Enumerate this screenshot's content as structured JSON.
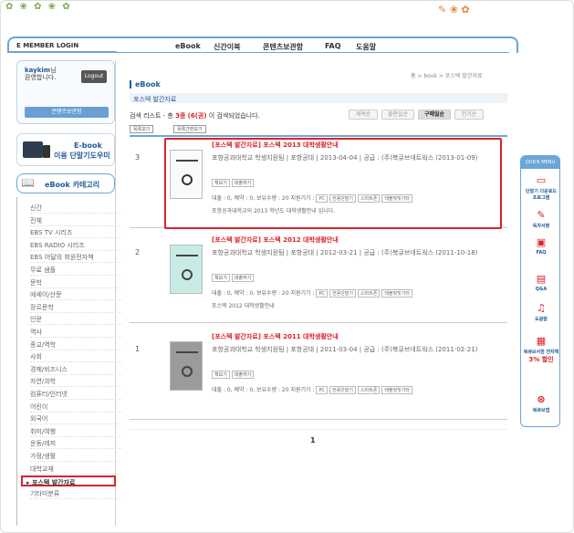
{
  "header": {
    "member_login": "E MEMBER LOGIN",
    "nav": [
      "eBook",
      "신간이북",
      "콘텐츠보관함",
      "FAQ",
      "도움말"
    ]
  },
  "login": {
    "user": "kaykim",
    "user_suffix": "님",
    "welcome": "환영합니다.",
    "logout": "Logout",
    "content_button": "콘텐츠보관함"
  },
  "app_promo": {
    "line1": "E-book",
    "line2": "이용 단말기도우미"
  },
  "category": {
    "title": "eBook 카테고리",
    "items": [
      "신간",
      "전체",
      "EBS TV 시리즈",
      "EBS RADIO 시리즈",
      "EBS 어달의 회원전자책",
      "무료 샘플",
      "문학",
      "에세이/산문",
      "장르문학",
      "인문",
      "역사",
      "종교/역학",
      "사회",
      "경제/비즈니스",
      "자연/과학",
      "컴퓨터/인터넷",
      "어린이",
      "외국어",
      "취미/여행",
      "운동/레저",
      "가정/생활",
      "대학교재",
      "포스텍 발간자료",
      "기타미분류"
    ],
    "active_index": 22
  },
  "main": {
    "section_title": "eBook",
    "breadcrumb": "홈 > book > 포스텍 발간자료",
    "sub_title": "포스텍 발간자료",
    "list_prefix": "검색 리스트 - 총 ",
    "list_count": "3종",
    "list_count_detail": "(6(권)",
    "list_suffix": " 이 검색되었습니다.",
    "sort_buttons": [
      "제목순",
      "출판일순",
      "구매일순",
      "인기순"
    ],
    "sort_selected": 2,
    "small_buttons": [
      "목록보기",
      "목록간편보기"
    ],
    "books": [
      {
        "num": "3",
        "series": "[포스텍 발간자료]",
        "title": "포스텍 2013 대학생활안내",
        "meta": "포항공과대학교 학생지원팀 | 포항공대 | 2013-04-04 | 공급 : (주)북큐브네트웍스 (2013-01-09)",
        "tools": [
          "책보기",
          "대출하기"
        ],
        "loan": "대출 : 0, 예약 : 0, 보유수량 : 20   지원기기 :",
        "devices": [
          "PC",
          "전용단말기",
          "스마트폰",
          "태블릿및기타"
        ],
        "desc": "포항공과대학교의 2013 학년도 대학생활안내 입니다."
      },
      {
        "num": "2",
        "series": "[포스텍 발간자료]",
        "title": "포스텍 2012 대학생활안내",
        "meta": "포항공과대학교 학생지원팀 | 포항공대 | 2012-03-21 | 공급 : (주)북큐브네트웍스 (2011-10-18)",
        "tools": [
          "책보기",
          "대출하기"
        ],
        "loan": "대출 : 0, 예약 : 0, 보유수량 : 20   지원기기 :",
        "devices": [
          "PC",
          "전용단말기",
          "스마트폰",
          "태블릿및기타"
        ],
        "desc": "포스텍 2012 대학생활안내"
      },
      {
        "num": "1",
        "series": "[포스텍 발간자료]",
        "title": "포스텍 2011 대학생활안내",
        "meta": "포항공과대학교 학생지원팀 | 포항공대 | 2011-03-04 | 공급 : (주)북큐브네트웍스 (2011-02-21)",
        "tools": [
          "책보기",
          "대출하기"
        ],
        "loan": "대출 : 0, 예약 : 0, 보유수량 : 20   지원기기 :",
        "devices": [
          "PC",
          "전용단말기",
          "스마트폰",
          "태블릿및기타"
        ],
        "desc": ""
      }
    ],
    "page": "1"
  },
  "quick_menu": {
    "title": "QUICK MENU",
    "items": [
      "단말기 다운로드 프로그램",
      "독자서평",
      "FAQ",
      "Q&A",
      "도움말",
      "북큐브서점 전자책",
      "3% 할인",
      "북큐브앱"
    ]
  }
}
